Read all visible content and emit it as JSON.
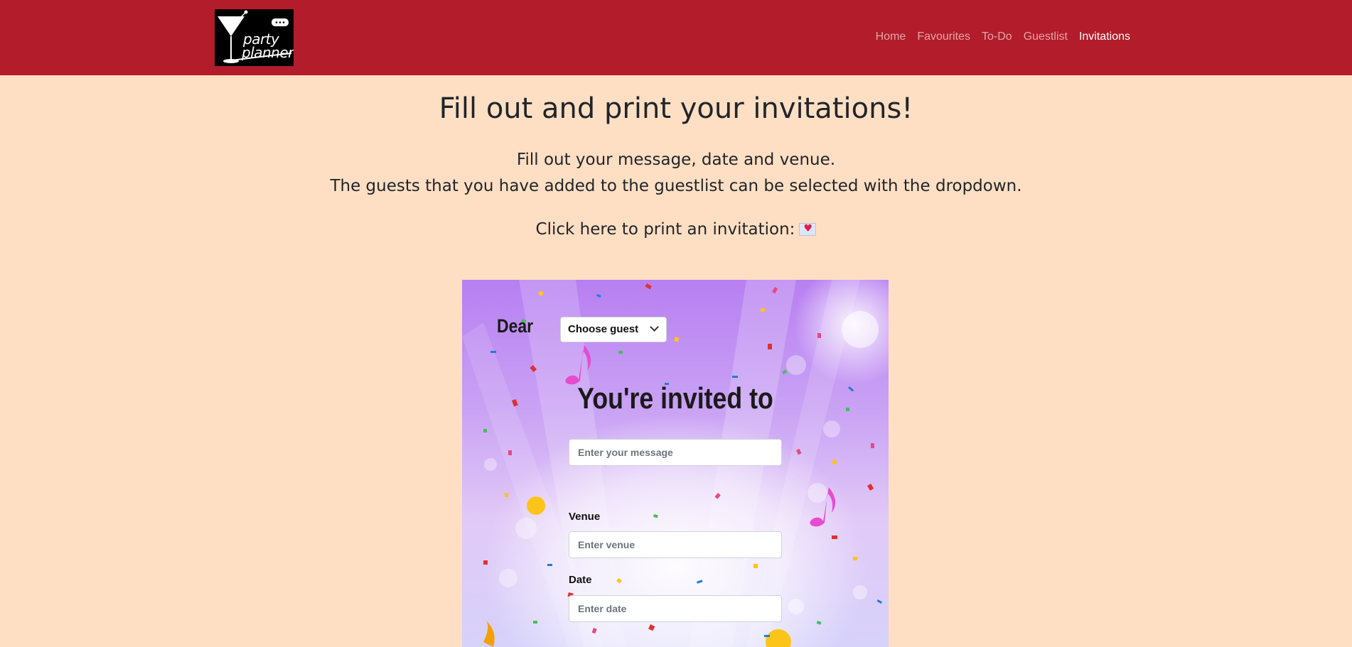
{
  "navbar": {
    "logo": {
      "line1": "party",
      "line2": "planner",
      "icon": "cocktail-glass-icon"
    },
    "links": [
      {
        "label": "Home",
        "active": false
      },
      {
        "label": "Favourites",
        "active": false
      },
      {
        "label": "To-Do",
        "active": false
      },
      {
        "label": "Guestlist",
        "active": false
      },
      {
        "label": "Invitations",
        "active": true
      }
    ]
  },
  "page": {
    "title": "Fill out and print your invitations!",
    "subtitle_line1": "Fill out your message, date and venue.",
    "subtitle_line2": "The guests that you have added to the guestlist can be selected with the dropdown.",
    "print_prompt": "Click here to print an invitation:",
    "print_icon": "love-letter-icon"
  },
  "invitation": {
    "dear": "Dear",
    "guest_select": "Choose guest",
    "headline": "You're invited to",
    "message_placeholder": "Enter your message",
    "venue_label": "Venue",
    "venue_placeholder": "Enter venue",
    "date_label": "Date",
    "date_placeholder": "Enter date"
  },
  "colors": {
    "navbar": "#b31c2a",
    "page_background": "#ffdfc4",
    "text": "#212529"
  }
}
